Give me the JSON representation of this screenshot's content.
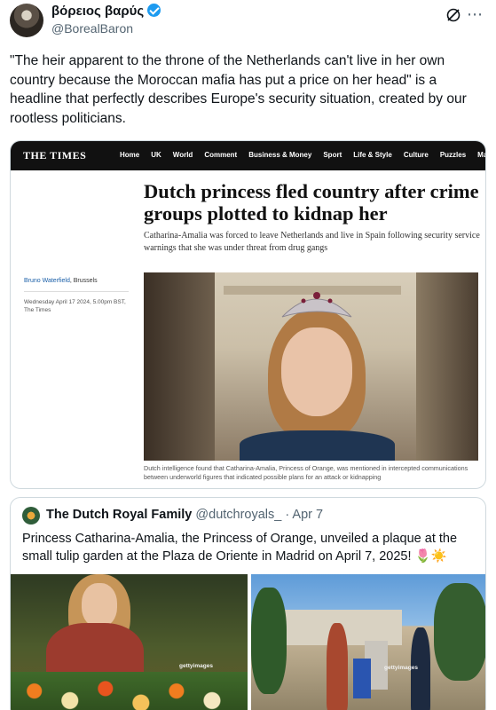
{
  "tweet": {
    "display_name": "βόρειος βαρύς",
    "handle": "@BorealBaron",
    "text": "\"The heir apparent to the throne of the Netherlands can't live in her own country because the Moroccan mafia has put a price on her head\" is a headline that perfectly describes Europe's security situation, created by our rootless politicians.",
    "icons": [
      "grok-icon",
      "more-icon"
    ]
  },
  "article": {
    "logo": "THE TIMES",
    "nav": [
      "Home",
      "UK",
      "World",
      "Comment",
      "Business & Money",
      "Sport",
      "Life & Style",
      "Culture",
      "Puzzles",
      "Magazi"
    ],
    "headline": "Dutch princess fled country after crime groups plotted to kidnap her",
    "standfirst": "Catharina-Amalia was forced to leave Netherlands and live in Spain following security service warnings that she was under threat from drug gangs",
    "author": "Bruno Waterfield",
    "location": ", Brussels",
    "date": "Wednesday April 17 2024, 5.00pm BST, The Times",
    "caption": "Dutch intelligence found that Catharina-Amalia, Princess of Orange, was mentioned in intercepted communications between underworld figures that indicated possible plans for an attack or kidnapping"
  },
  "quote": {
    "display_name": "The Dutch Royal Family",
    "handle": "@dutchroyals_",
    "date": "· Apr 7",
    "text": "Princess Catharina-Amalia, the Princess of Orange, unveiled a plaque at the small tulip garden at the Plaza de Oriente in Madrid on April 7, 2025! 🌷☀️",
    "watermark_left": "gettyimages",
    "watermark_right": "gettyimages"
  }
}
